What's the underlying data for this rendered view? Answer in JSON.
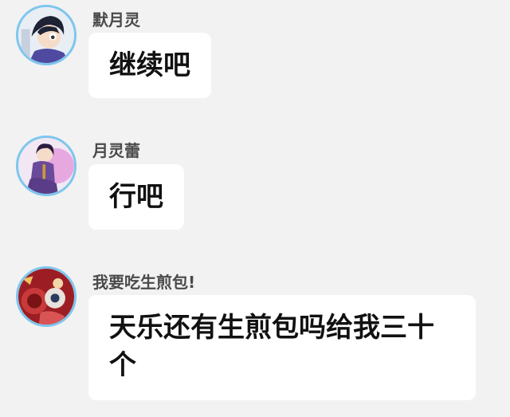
{
  "messages": [
    {
      "username": "默月灵",
      "text": "继续吧",
      "avatar_icon": "anime-boy-avatar-icon"
    },
    {
      "username": "月灵蕾",
      "text": "行吧",
      "avatar_icon": "anime-girl-purple-avatar-icon"
    },
    {
      "username": "我要吃生煎包!",
      "text": "天乐还有生煎包吗给我三十个",
      "avatar_icon": "red-anime-avatar-icon"
    }
  ],
  "colors": {
    "background": "#f2f2f2",
    "bubble": "#ffffff",
    "avatar_ring": "#7ec6ee",
    "username": "#4a4a4a",
    "message_text": "#111111"
  }
}
